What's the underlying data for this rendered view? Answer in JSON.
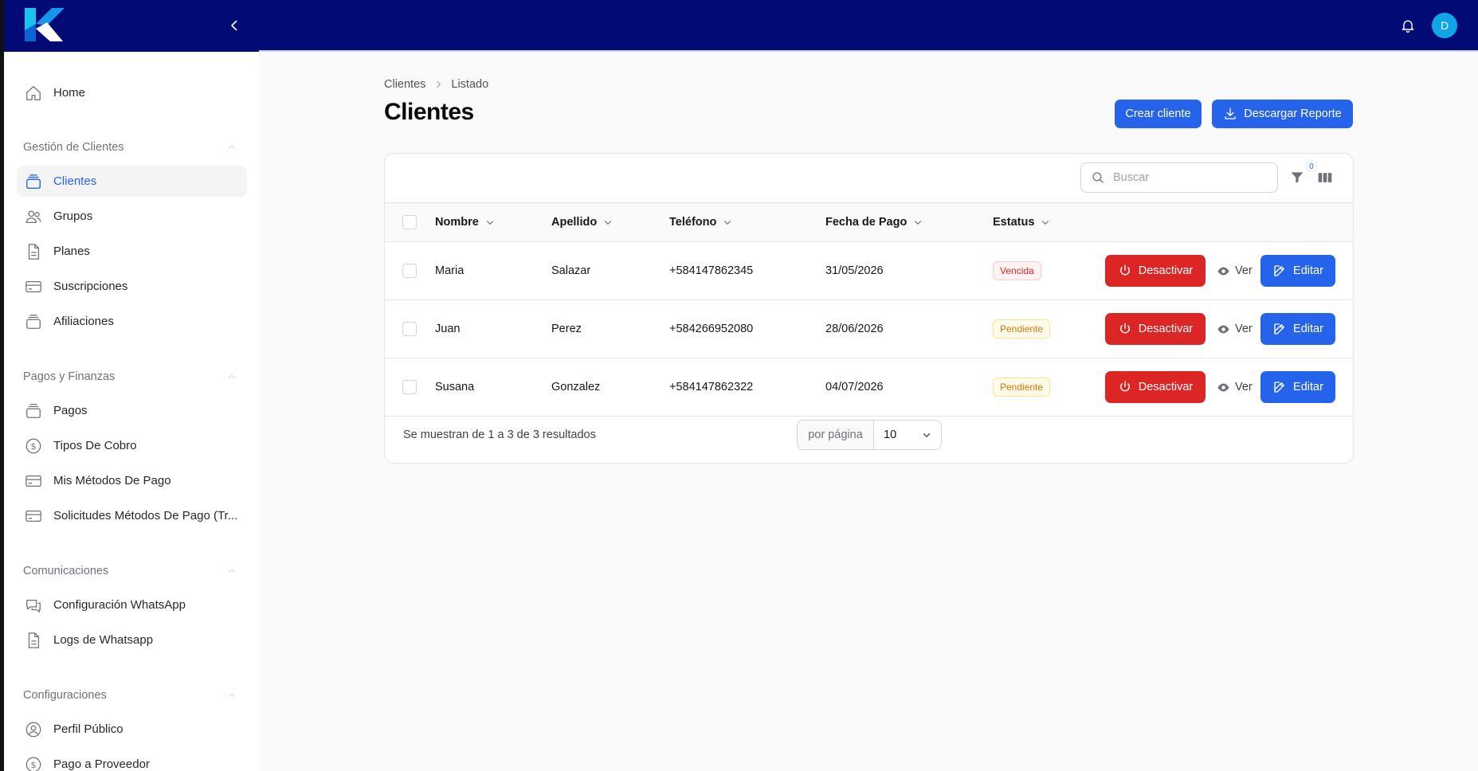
{
  "header": {
    "logo": "K",
    "avatar_initial": "D"
  },
  "sidebar": {
    "home": "Home",
    "groups": [
      {
        "title": "Gestión de Clientes",
        "items": [
          "Clientes",
          "Grupos",
          "Planes",
          "Suscripciones",
          "Afiliaciones"
        ]
      },
      {
        "title": "Pagos y Finanzas",
        "items": [
          "Pagos",
          "Tipos De Cobro",
          "Mis Métodos De Pago",
          "Solicitudes Métodos De Pago (Tr..."
        ]
      },
      {
        "title": "Comunicaciones",
        "items": [
          "Configuración WhatsApp",
          "Logs de Whatsapp"
        ]
      },
      {
        "title": "Configuraciones",
        "items": [
          "Perfil Público",
          "Pago a Proveedor"
        ]
      }
    ],
    "active_item": "Clientes"
  },
  "breadcrumb": [
    "Clientes",
    "Listado"
  ],
  "page_title": "Clientes",
  "actions": {
    "create": "Crear cliente",
    "download": "Descargar Reporte"
  },
  "table": {
    "search_placeholder": "Buscar",
    "filter_count": "0",
    "columns": [
      "Nombre",
      "Apellido",
      "Teléfono",
      "Fecha de Pago",
      "Estatus"
    ],
    "rows": [
      {
        "nombre": "Maria",
        "apellido": "Salazar",
        "telefono": "+584147862345",
        "fecha": "31/05/2026",
        "estatus": "Vencida",
        "estatus_color": "#dc2626"
      },
      {
        "nombre": "Juan",
        "apellido": "Perez",
        "telefono": "+584266952080",
        "fecha": "28/06/2026",
        "estatus": "Pendiente",
        "estatus_color": "#d97706"
      },
      {
        "nombre": "Susana",
        "apellido": "Gonzalez",
        "telefono": "+584147862322",
        "fecha": "04/07/2026",
        "estatus": "Pendiente",
        "estatus_color": "#d97706"
      }
    ],
    "row_actions": {
      "deactivate": "Desactivar",
      "view": "Ver",
      "edit": "Editar"
    },
    "footer": {
      "summary": "Se muestran de 1 a 3 de 3 resultados",
      "per_page_label": "por página",
      "per_page_value": "10"
    }
  },
  "colors": {
    "topbar": "#020a75",
    "primary": "#2563eb",
    "danger": "#dc2626",
    "warning": "#d97706"
  }
}
